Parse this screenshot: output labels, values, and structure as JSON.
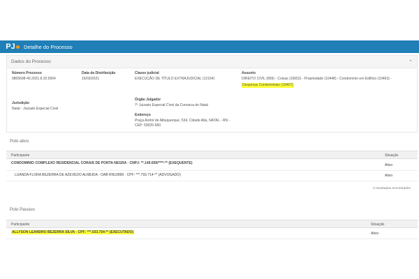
{
  "header": {
    "logo": "PJ",
    "title": "Detalhe do Processo"
  },
  "dados": {
    "section_title": "Dados do Processo",
    "numero_label": "Número Processo",
    "numero_value": "0805698-40.2021.8.20.5004",
    "data_label": "Data da Distribuição",
    "data_value": "16/03/2021",
    "classe_label": "Classe judicial",
    "classe_value": "EXECUÇÃO DE TÍTULO EXTRAJUDICIAL (12154)",
    "assunto_label": "Assunto",
    "assunto_value_1": "DIREITO CIVIL (899) - Coisas (10652) - Propriedade (10448) - Condomínio em Edifício (10463) -",
    "assunto_value_2": "Despesas Condominiais (10467)",
    "jurisdicao_label": "Jurisdição",
    "jurisdicao_value": "Natal - Juizado Especial Cível",
    "orgao_label": "Órgão Julgador",
    "orgao_value": "7º Juizado Especial Cível da Comarca de Natal",
    "endereco_label": "Endereço",
    "endereco_value_1": "Praça André de Albuquerque, 534, Cidade Alta, NATAL - RN -",
    "endereco_value_2": "CEP: 59025-580"
  },
  "polo_ativo": {
    "title": "Polo ativo",
    "col_participante": "Participante",
    "col_situacao": "Situação",
    "rows": [
      {
        "participante": "CONDOMINIO COMPLEXO RESIDENCIAL CORAIS DE PONTA NEGRA - CNPJ: **.149.659/****-** (EXEQUENTE)",
        "situacao": "Ativo"
      },
      {
        "participante": "LUANDA FLORA BEZERRA DE AZEVEDO ALMEIDA - OAB RN10899 - CPF: ***.793.714-** (ADVOGADO)",
        "situacao": "Ativo"
      }
    ],
    "footer": "2 resultados encontrados"
  },
  "polo_passivo": {
    "title": "Polo Passivo",
    "col_participante": "Participante",
    "col_situacao": "Situação",
    "rows": [
      {
        "participante": "ALLYSON LEANDRO BEZERRA SILVA - CPF: ***.033.754-** (EXECUTADO)",
        "situacao": "Ativo"
      }
    ]
  },
  "colors": {
    "topbar": "#1f7fb6",
    "highlight": "#ffff3a"
  }
}
